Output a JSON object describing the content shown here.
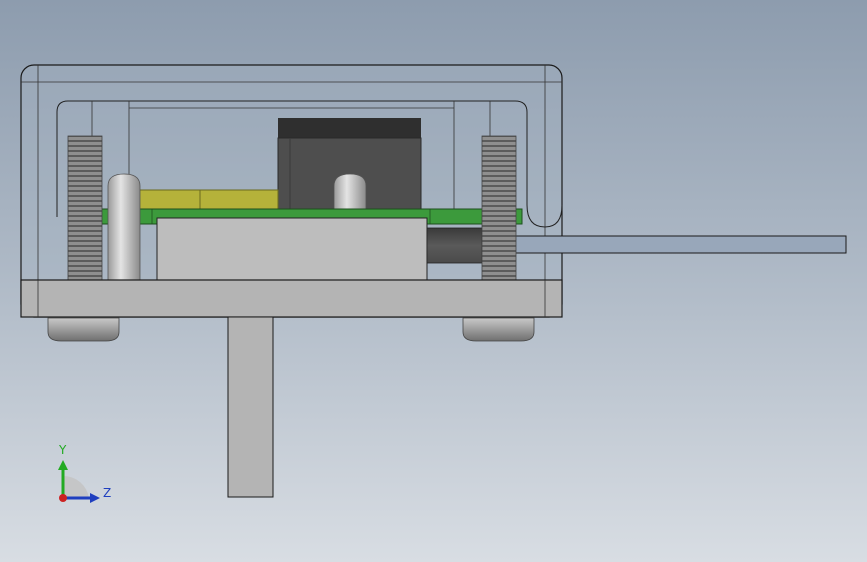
{
  "viewport": {
    "background_top": "#8d9cae",
    "background_bottom": "#d8dde3"
  },
  "model": {
    "housing_outline": "#1a1a1a",
    "base_plate_color": "#b4b4b4",
    "pcb_color": "#3c9a3c",
    "component_yellow": "#b5b23a",
    "connector_dark": "#4a4a4a",
    "screw_color": "#9a9a9a"
  },
  "triad": {
    "y_label": "Y",
    "z_label": "Z",
    "y_color": "#22aa22",
    "z_color": "#1f3fbf",
    "x_color": "#cc2222"
  }
}
